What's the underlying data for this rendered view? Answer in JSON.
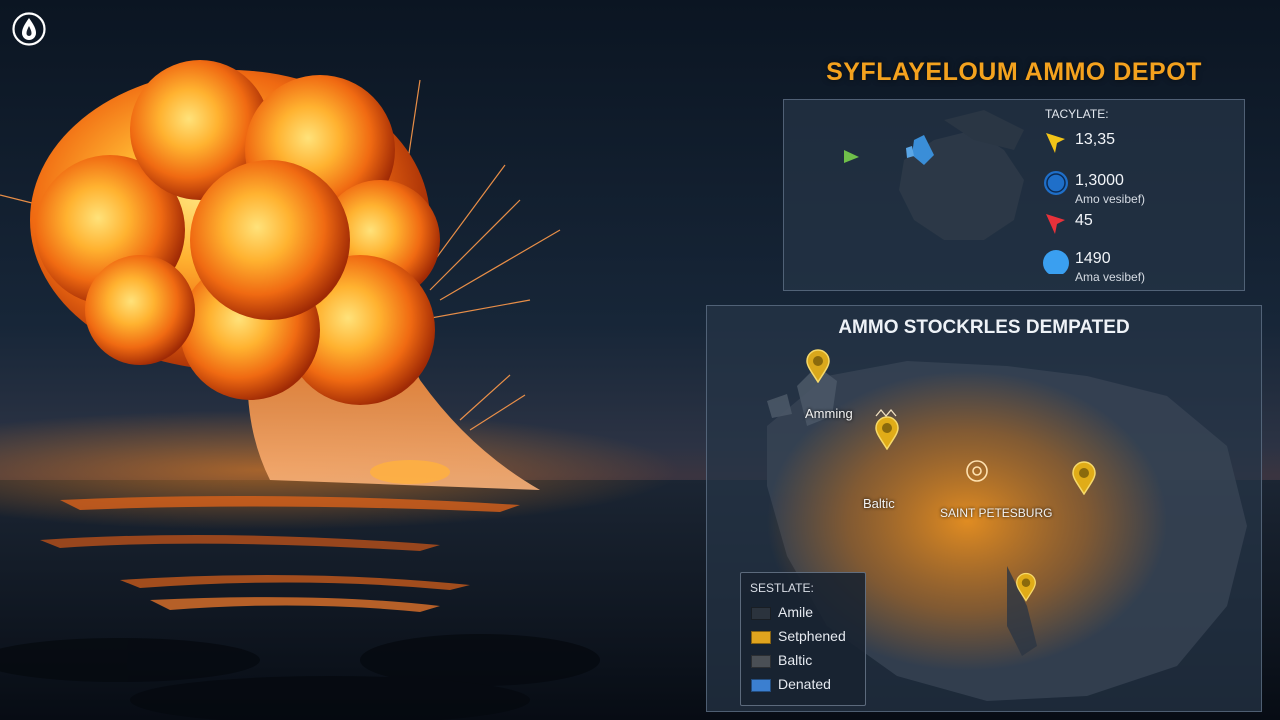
{
  "header": {
    "title": "SYFLAYELOUM AMMO DEPOT"
  },
  "logo": {
    "icon": "flame-icon"
  },
  "stats_panel": {
    "header": "TACYLATE:",
    "items": [
      {
        "icon": "pin-marker-icon",
        "color": "#f2c418",
        "value": "13,35",
        "sub": ""
      },
      {
        "icon": "circle-target-icon",
        "color": "#1f6fc9",
        "value": "1,3000",
        "sub": "Amo vesibef)"
      },
      {
        "icon": "pin-marker-icon",
        "color": "#e8313a",
        "value": "45",
        "sub": ""
      },
      {
        "icon": "dot-icon",
        "color": "#3a9ff0",
        "value": "1490",
        "sub": "Ama vesibef)"
      }
    ]
  },
  "map_panel": {
    "title": "AMMO STOCKRLES DEMPATED",
    "labels": {
      "amming": "Amming",
      "baltic": "Baltic",
      "saint_petesburg": "SAINT PETESBURG"
    },
    "legend": {
      "header": "SESTLATE:",
      "items": [
        {
          "label": "Amile",
          "color": "#2b333d"
        },
        {
          "label": "Setphened",
          "color": "#e0a41e"
        },
        {
          "label": "Baltic",
          "color": "#4a4f55"
        },
        {
          "label": "Denated",
          "color": "#3b7fd0"
        }
      ]
    }
  }
}
